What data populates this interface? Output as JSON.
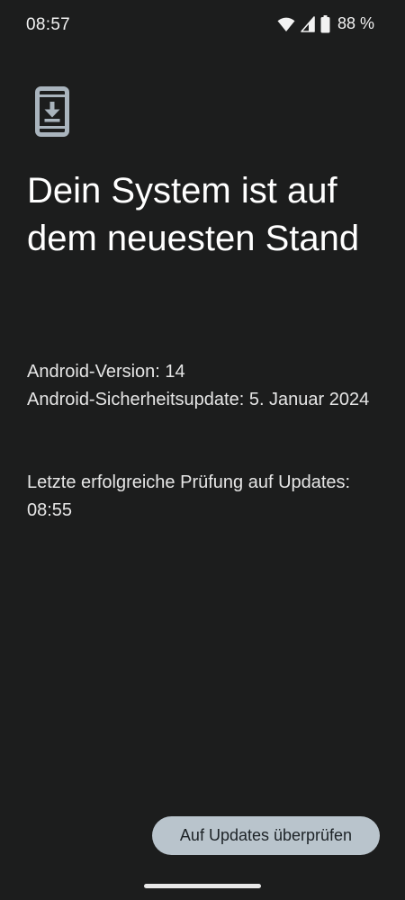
{
  "status_bar": {
    "time": "08:57",
    "battery_percent": "88 %",
    "icons": [
      "wifi-icon",
      "signal-icon",
      "battery-icon"
    ]
  },
  "main": {
    "icon": "system-update-icon",
    "headline": "Dein System ist auf dem neuesten Stand",
    "android_version": "Android-Version: 14",
    "security_update": "Android-Sicherheitsupdate: 5. Januar 2024",
    "last_check_label": "Letzte erfolgreiche Prüfung auf Updates:",
    "last_check_time": "08:55"
  },
  "actions": {
    "check_updates_label": "Auf Updates überprüfen"
  },
  "colors": {
    "background": "#1c1d1d",
    "text": "#ffffff",
    "button_bg": "#b9c4cc",
    "button_text": "#1d2327",
    "icon": "#a9b4bd"
  }
}
